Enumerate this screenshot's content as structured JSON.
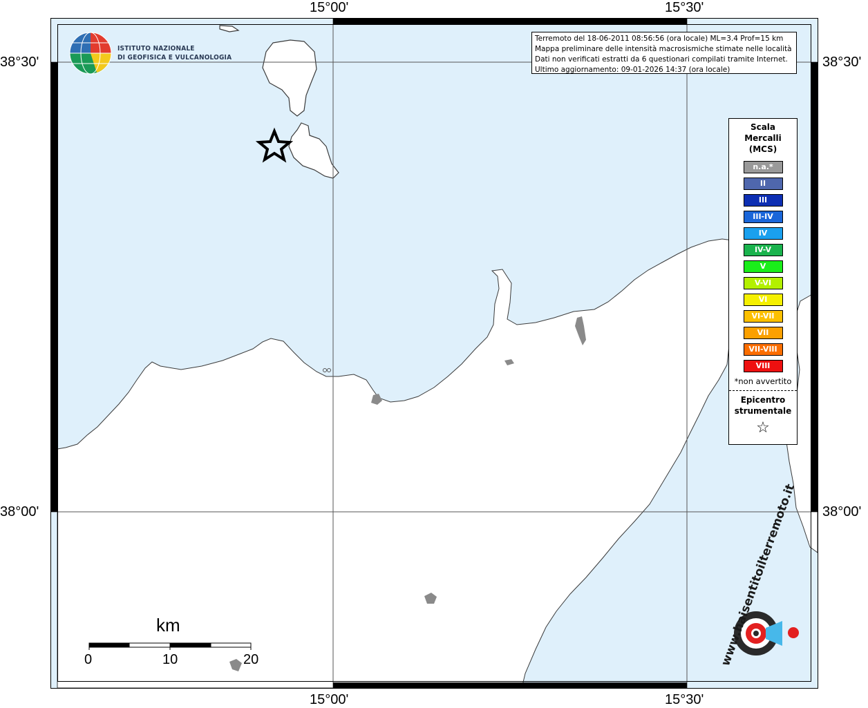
{
  "map": {
    "info_lines": [
      "Terremoto del 18-06-2011 08:56:56 (ora locale) ML=3.4 Prof=15 km",
      "Mappa preliminare delle intensità macrosismiche stimate nelle località",
      "Dati non verificati estratti da 6 questionari compilati tramite Internet.",
      "Ultimo aggiornamento: 09-01-2026 14:37 (ora locale)"
    ],
    "lon_labels": [
      "15°00'",
      "15°30'"
    ],
    "lat_labels": [
      "38°30'",
      "38°00'"
    ],
    "colors": {
      "sea": "#dff0fb",
      "land": "#ffffff",
      "coast": "#3a3a3a",
      "island_grey": "#8a8a8a"
    },
    "epicenter_icon": "star-icon"
  },
  "legend": {
    "title_lines": [
      "Scala",
      "Mercalli",
      "(MCS)"
    ],
    "items": [
      {
        "label": "n.a.*",
        "color": "#999999"
      },
      {
        "label": "II",
        "color": "#4f67ad"
      },
      {
        "label": "III",
        "color": "#0d2fb3"
      },
      {
        "label": "III-IV",
        "color": "#1a66d9"
      },
      {
        "label": "IV",
        "color": "#1aa0ee"
      },
      {
        "label": "IV-V",
        "color": "#1ab34d"
      },
      {
        "label": "V",
        "color": "#1aee1a"
      },
      {
        "label": "V-VI",
        "color": "#b3f000"
      },
      {
        "label": "VI",
        "color": "#f5f000"
      },
      {
        "label": "VI-VII",
        "color": "#fcc000"
      },
      {
        "label": "VII",
        "color": "#fca000"
      },
      {
        "label": "VII-VIII",
        "color": "#fb6e00"
      },
      {
        "label": "VIII",
        "color": "#ee1010"
      }
    ],
    "note": "*non avvertito",
    "epicenter_lines": [
      "Epicentro",
      "strumentale"
    ],
    "star": "☆"
  },
  "scale_bar": {
    "unit": "km",
    "ticks": [
      "0",
      "10",
      "20"
    ]
  },
  "ingv": {
    "lines": [
      "ISTITUTO NAZIONALE",
      "DI GEOFISICA E VULCANOLOGIA"
    ]
  },
  "hst": {
    "text": "www.haisentitoilterremoto.it"
  }
}
